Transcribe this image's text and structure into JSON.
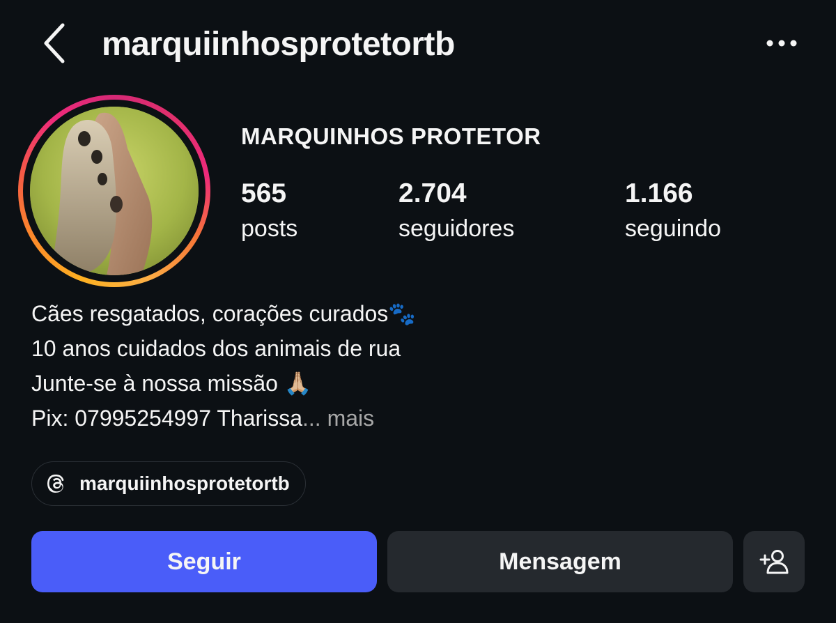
{
  "header": {
    "username": "marquiinhosprotetortb",
    "back_icon": "chevron-left-icon",
    "more_icon": "more-horizontal-icon"
  },
  "profile": {
    "display_name": "MARQUINHOS PROTETOR",
    "avatar_description": "photo-paw-and-hand",
    "stats": [
      {
        "value": "565",
        "label": "posts"
      },
      {
        "value": "2.704",
        "label": "seguidores"
      },
      {
        "value": "1.166",
        "label": "seguindo"
      }
    ]
  },
  "bio": {
    "line1": "Cães resgatados, corações curados",
    "line1_emoji": "🐾",
    "line2": "10 anos cuidados dos animais de rua",
    "line3": "Junte-se à nossa missão",
    "line3_emoji": "🙏🏼",
    "line4": "Pix: 07995254997 Tharissa",
    "ellipsis": "...",
    "more_label": "mais"
  },
  "threads_link": {
    "icon": "threads-icon",
    "label": "marquiinhosprotetortb"
  },
  "actions": {
    "follow_label": "Seguir",
    "message_label": "Mensagem",
    "add_user_icon": "add-person-icon"
  },
  "colors": {
    "background": "#0c1014",
    "follow_button": "#4a5df9",
    "secondary_button": "#25292e",
    "muted_text": "#a8a8a8"
  }
}
